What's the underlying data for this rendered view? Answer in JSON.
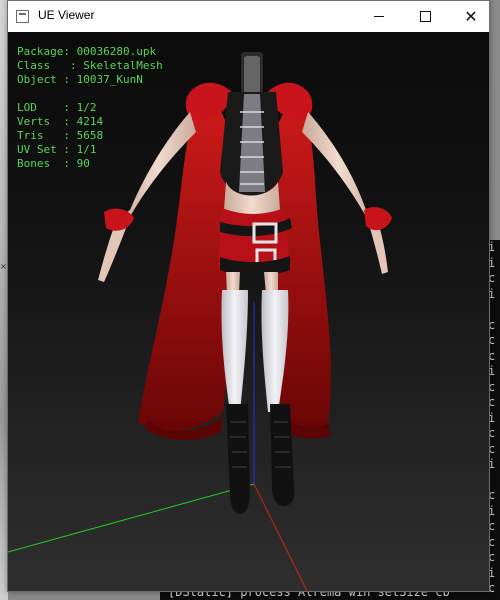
{
  "window": {
    "title": "UE Viewer",
    "icon": "app-window-icon",
    "controls": {
      "minimize": "minimize-icon",
      "maximize": "maximize-icon",
      "close": "✕"
    }
  },
  "info": {
    "package_label": "Package",
    "package_value": "00036280.upk",
    "class_label": "Class",
    "class_value": "SkeletalMesh",
    "object_label": "Object",
    "object_value": "10037_KunN",
    "lod_label": "LOD",
    "lod_value": "1/2",
    "verts_label": "Verts",
    "verts_value": "4214",
    "tris_label": "Tris",
    "tris_value": "5658",
    "uvset_label": "UV Set",
    "uvset_value": "1/1",
    "bones_label": "Bones",
    "bones_value": "90"
  },
  "console": {
    "right_lines": [
      "i",
      "i",
      "c",
      "i",
      "",
      "c",
      "c",
      "c",
      "i",
      "c",
      "c",
      "i",
      "c",
      "c",
      "i",
      "",
      "c",
      "i",
      "c",
      "c",
      "c",
      "i",
      "c"
    ],
    "bottom_line": "[DStatic] process  Alrema win setSize  cb"
  },
  "colors": {
    "info_text": "#58d658",
    "axis_x": "#cc2222",
    "axis_y": "#22cc22",
    "axis_z": "#2233dd",
    "cape": "#b01010",
    "skin": "#e8cfc0",
    "stocking": "#e9e9ee"
  }
}
